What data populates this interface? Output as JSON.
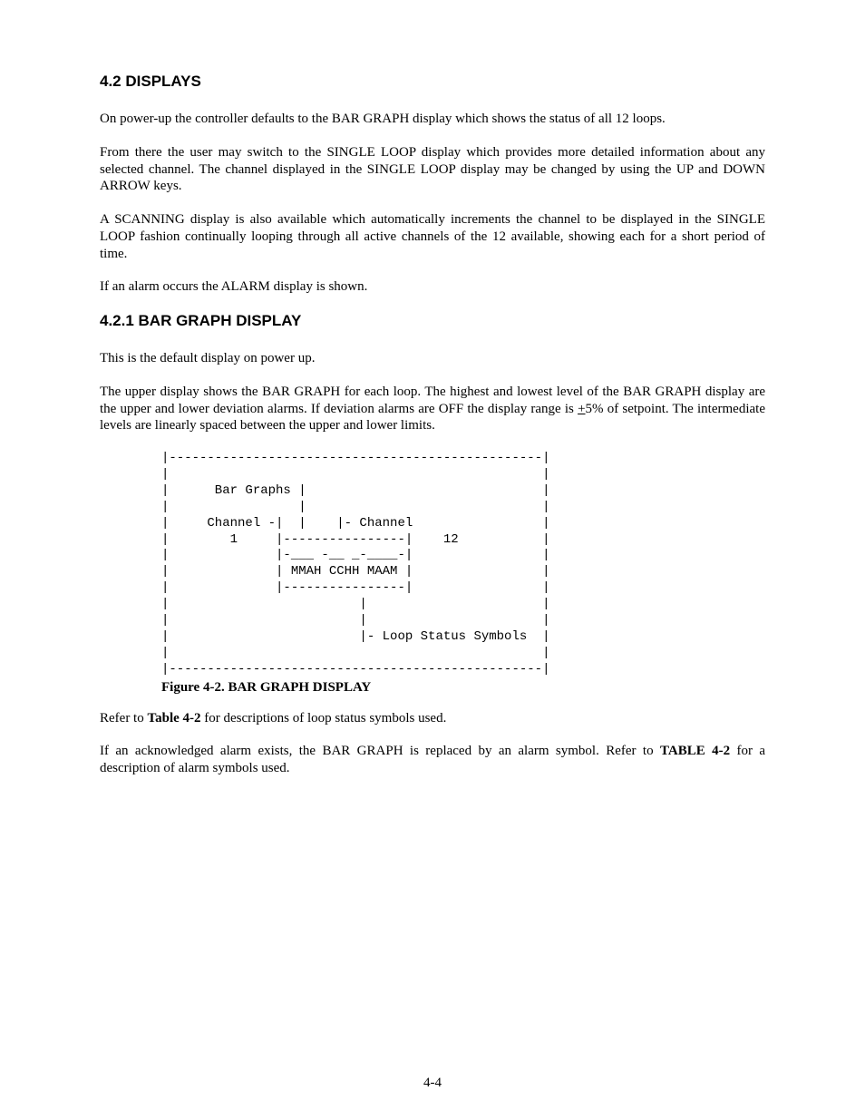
{
  "section_heading": "4.2 DISPLAYS",
  "para1": "On power-up the controller defaults to the BAR GRAPH display which shows the status of all 12 loops.",
  "para2": "From there the user may switch to the SINGLE LOOP display which provides more detailed information about any selected channel. The channel displayed in the SINGLE LOOP display may be changed by using the UP and DOWN ARROW keys.",
  "para3": "A SCANNING display is also available which automatically increments the channel to be displayed in the SINGLE LOOP fashion continually looping through all active channels of the 12 available, showing each for a short period of time.",
  "para4": "If an alarm occurs the ALARM display is shown.",
  "subsection_heading": "4.2.1 BAR GRAPH DISPLAY",
  "para5": "This is the default display on power up.",
  "para6_parts": {
    "a": "The upper display shows the BAR GRAPH for each loop.  The highest and lowest level of the BAR GRAPH display are the upper and lower deviation alarms.  If deviation alarms are OFF the display range is ",
    "u": "+",
    "b": "5% of setpoint.  The intermediate levels are linearly spaced between the upper and lower limits."
  },
  "ascii_art": "|-------------------------------------------------|\n|                                                 |\n|      Bar Graphs |                               |\n|                 |                               |\n|     Channel -|  |    |- Channel                 |\n|        1     |----------------|    12           |\n|              |-___ -__ _-____-|                 |\n|              | MMAH CCHH MAAM |                 |\n|              |----------------|                 |\n|                         |                       |\n|                         |                       |\n|                         |- Loop Status Symbols  |\n|                                                 |\n|-------------------------------------------------|",
  "figure_caption": "Figure 4-2.  BAR GRAPH DISPLAY",
  "para7_parts": {
    "a": "Refer to ",
    "bold": "Table 4-2",
    "b": " for descriptions of loop status symbols used."
  },
  "para8_parts": {
    "a": "If an acknowledged alarm exists, the BAR GRAPH is replaced by an alarm symbol.  Refer to ",
    "bold": "TABLE 4-2",
    "b": " for a description of alarm symbols used."
  },
  "page_number": "4-4"
}
